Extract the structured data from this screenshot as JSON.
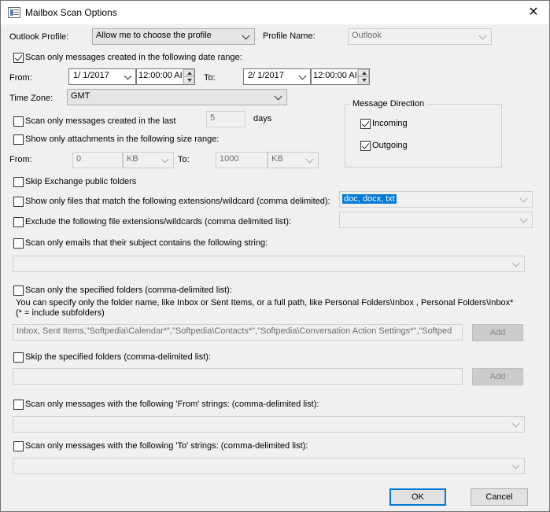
{
  "window": {
    "title": "Mailbox Scan Options",
    "close": "✕"
  },
  "profile": {
    "outlook_label": "Outlook Profile:",
    "outlook_value": "Allow me to choose the profile",
    "name_label": "Profile Name:",
    "name_value": "Outlook"
  },
  "date_range": {
    "checkbox_label": "Scan only messages created in the following date range:",
    "from_label": "From:",
    "from_date": "1/  1/2017",
    "from_time": "12:00:00 AI",
    "to_label": "To:",
    "to_date": "2/  1/2017",
    "to_time": "12:00:00 AI"
  },
  "timezone": {
    "label": "Time Zone:",
    "value": "GMT"
  },
  "last": {
    "label": "Scan only messages created in the last",
    "value": "5",
    "unit": "days"
  },
  "size": {
    "label": "Show only attachments in the following size range:",
    "from_label": "From:",
    "from_value": "0",
    "from_unit": "KB",
    "to_label": "To:",
    "to_value": "1000",
    "to_unit": "KB"
  },
  "direction": {
    "title": "Message Direction",
    "incoming": "Incoming",
    "outgoing": "Outgoing"
  },
  "skip_public": "Skip Exchange public folders",
  "ext_match": {
    "label": "Show only files that match the following extensions/wildcard (comma delimited):",
    "value": "doc, docx, txt"
  },
  "ext_exclude": {
    "label": "Exclude the following file extensions/wildcards (comma delimited list):",
    "value": ""
  },
  "subject": {
    "label": "Scan only emails that their subject contains the following string:",
    "value": ""
  },
  "folders": {
    "label": "Scan only the specified folders (comma-delimited list):",
    "help_line1": "You can specify only the folder name, like Inbox or Sent Items, or a full path, like Personal Folders\\Inbox , Personal Folders\\Inbox*",
    "help_line2": "(* = include subfolders)",
    "value": "Inbox, Sent Items,\"Softpedia\\Calendar*\",\"Softpedia\\Contacts*\",\"Softpedia\\Conversation Action Settings*\",\"Softped",
    "add": "Add"
  },
  "skip_folders": {
    "label": "Skip the specified folders (comma-delimited list):",
    "value": "",
    "add": "Add"
  },
  "from_strings": {
    "label": "Scan only messages with the following 'From' strings: (comma-delimited list):",
    "value": ""
  },
  "to_strings": {
    "label": "Scan only messages with the following 'To' strings: (comma-delimited list):",
    "value": ""
  },
  "buttons": {
    "ok": "OK",
    "cancel": "Cancel"
  }
}
